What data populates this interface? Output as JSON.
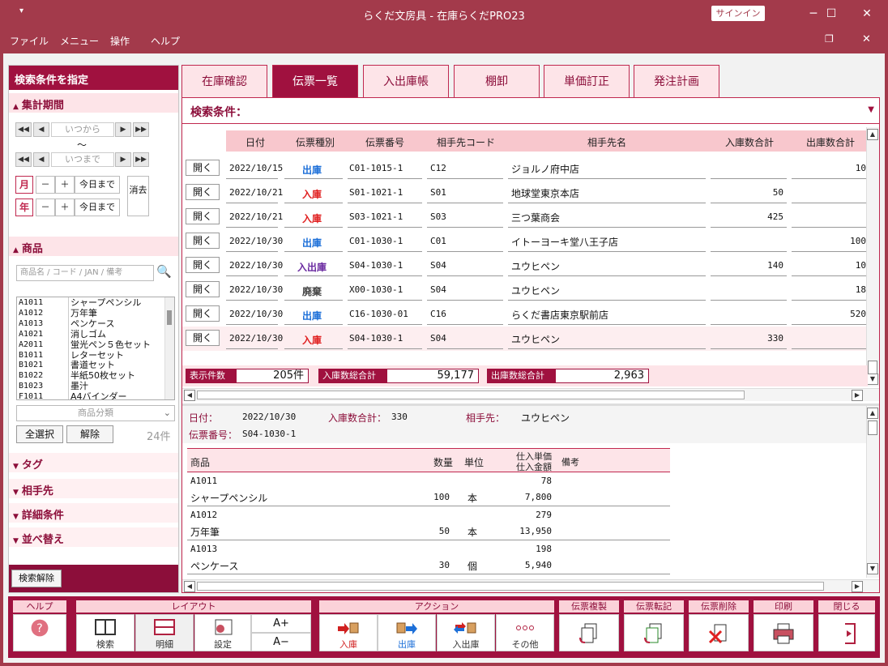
{
  "window": {
    "title": "らくだ文房具 - 在庫らくだPRO23",
    "signin": "サインイン",
    "menu_icon": "▾"
  },
  "menu": [
    "ファイル",
    "メニュー",
    "操作",
    "ヘルプ"
  ],
  "left": {
    "header": "検索条件を指定",
    "period_section": "集計期間",
    "from_placeholder": "いつから",
    "tilde": "～",
    "to_placeholder": "いつまで",
    "month": "月",
    "year": "年",
    "minus": "－",
    "plus": "＋",
    "today": "今日まで",
    "clear": "消去",
    "product_section": "商品",
    "search_placeholder": "商品名 / コード / JAN / 備考",
    "products": [
      {
        "code": "A1011",
        "name": "シャープペンシル"
      },
      {
        "code": "A1012",
        "name": "万年筆"
      },
      {
        "code": "A1013",
        "name": "ペンケース"
      },
      {
        "code": "A1021",
        "name": "消しゴム"
      },
      {
        "code": "A2011",
        "name": "蛍光ペン５色セット"
      },
      {
        "code": "B1011",
        "name": "レターセット"
      },
      {
        "code": "B1021",
        "name": "書道セット"
      },
      {
        "code": "B1022",
        "name": "半紙50枚セット"
      },
      {
        "code": "B1023",
        "name": "墨汁"
      },
      {
        "code": "F1011",
        "name": "A4バインダー"
      }
    ],
    "category_placeholder": "商品分類",
    "select_all": "全選択",
    "deselect": "解除",
    "count": "24件",
    "tag_section": "タグ",
    "partner_section": "相手先",
    "detail_section": "詳細条件",
    "sort_section": "並べ替え",
    "clear_search": "検索解除"
  },
  "tabs": [
    "在庫確認",
    "伝票一覧",
    "入出庫帳",
    "棚卸",
    "単価訂正",
    "発注計画"
  ],
  "search_condition": "検索条件：",
  "columns": [
    "日付",
    "伝票種別",
    "伝票番号",
    "相手先コード",
    "相手先名",
    "入庫数合計",
    "出庫数合計"
  ],
  "open_label": "開く",
  "rows": [
    {
      "date": "2022/10/15",
      "kind": "出庫",
      "kcolor": "#1c6fd8",
      "no": "C01-1015-1",
      "code": "C12",
      "name": "ジョルノ府中店",
      "in": "",
      "out": "10"
    },
    {
      "date": "2022/10/21",
      "kind": "入庫",
      "kcolor": "#e02020",
      "no": "S01-1021-1",
      "code": "S01",
      "name": "地球堂東京本店",
      "in": "50",
      "out": ""
    },
    {
      "date": "2022/10/21",
      "kind": "入庫",
      "kcolor": "#e02020",
      "no": "S03-1021-1",
      "code": "S03",
      "name": "三つ葉商会",
      "in": "425",
      "out": ""
    },
    {
      "date": "2022/10/30",
      "kind": "出庫",
      "kcolor": "#1c6fd8",
      "no": "C01-1030-1",
      "code": "C01",
      "name": "イトーヨーキ堂八王子店",
      "in": "",
      "out": "100"
    },
    {
      "date": "2022/10/30",
      "kind": "入出庫",
      "kcolor": "#6a2aa0",
      "no": "S04-1030-1",
      "code": "S04",
      "name": "ユウヒペン",
      "in": "140",
      "out": "10"
    },
    {
      "date": "2022/10/30",
      "kind": "廃棄",
      "kcolor": "#444444",
      "no": "X00-1030-1",
      "code": "S04",
      "name": "ユウヒペン",
      "in": "",
      "out": "18"
    },
    {
      "date": "2022/10/30",
      "kind": "出庫",
      "kcolor": "#1c6fd8",
      "no": "C16-1030-01",
      "code": "C16",
      "name": "らくだ書店東京駅前店",
      "in": "",
      "out": "520"
    },
    {
      "date": "2022/10/30",
      "kind": "入庫",
      "kcolor": "#e02020",
      "no": "S04-1030-1",
      "code": "S04",
      "name": "ユウヒペン",
      "in": "330",
      "out": ""
    }
  ],
  "summary": {
    "count_label": "表示件数",
    "count": "205件",
    "in_label": "入庫数総合計",
    "in_total": "59,177",
    "out_label": "出庫数総合計",
    "out_total": "2,963"
  },
  "detail": {
    "date_label": "日付：",
    "date": "2022/10/30",
    "in_label": "入庫数合計：",
    "in": "330",
    "partner_label": "相手先：",
    "partner": "ユウヒペン",
    "no_label": "伝票番号：",
    "no": "S04-1030-1",
    "col_product": "商品",
    "col_qty": "数量",
    "col_unit": "単位",
    "col_price": "仕入単価",
    "col_amount": "仕入金額",
    "col_note": "備考",
    "items": [
      {
        "code": "A1011",
        "name": "シャープペンシル",
        "qty": "100",
        "unit": "本",
        "price": "78",
        "amount": "7,800"
      },
      {
        "code": "A1012",
        "name": "万年筆",
        "qty": "50",
        "unit": "本",
        "price": "279",
        "amount": "13,950"
      },
      {
        "code": "A1013",
        "name": "ペンケース",
        "qty": "30",
        "unit": "個",
        "price": "198",
        "amount": "5,940"
      }
    ]
  },
  "toolbar": {
    "help_group": "ヘルプ",
    "layout_group": "レイアウト",
    "action_group": "アクション",
    "search": "検索",
    "detail": "明細",
    "settings": "設定",
    "font_up": "A+",
    "font_down": "A−",
    "in": "入庫",
    "out": "出庫",
    "inout": "入出庫",
    "other": "その他",
    "copy": "伝票複製",
    "transfer": "伝票転記",
    "delete": "伝票削除",
    "print": "印刷",
    "close": "閉じる"
  }
}
